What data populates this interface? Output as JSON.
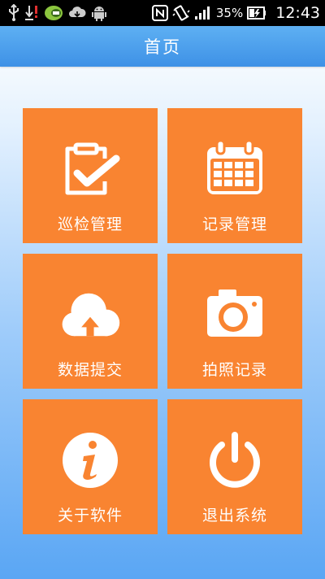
{
  "status_bar": {
    "battery_percent": "35%",
    "time": "12:43",
    "icons": [
      "usb-icon",
      "download-error-icon",
      "app-notification-icon",
      "cloud-download-icon",
      "android-icon",
      "nfc-icon",
      "vibrate-icon",
      "signal-icon",
      "battery-charging-icon"
    ]
  },
  "header": {
    "title": "首页"
  },
  "menu": {
    "items": [
      {
        "label": "巡检管理",
        "icon": "clipboard-check-icon"
      },
      {
        "label": "记录管理",
        "icon": "calendar-icon"
      },
      {
        "label": "数据提交",
        "icon": "cloud-upload-icon"
      },
      {
        "label": "拍照记录",
        "icon": "camera-icon"
      },
      {
        "label": "关于软件",
        "icon": "info-icon"
      },
      {
        "label": "退出系统",
        "icon": "power-icon"
      }
    ]
  },
  "colors": {
    "tile": "#f98431",
    "title_bar": "#4a9eea",
    "status_bar": "#000000",
    "icon": "#ffffff"
  }
}
